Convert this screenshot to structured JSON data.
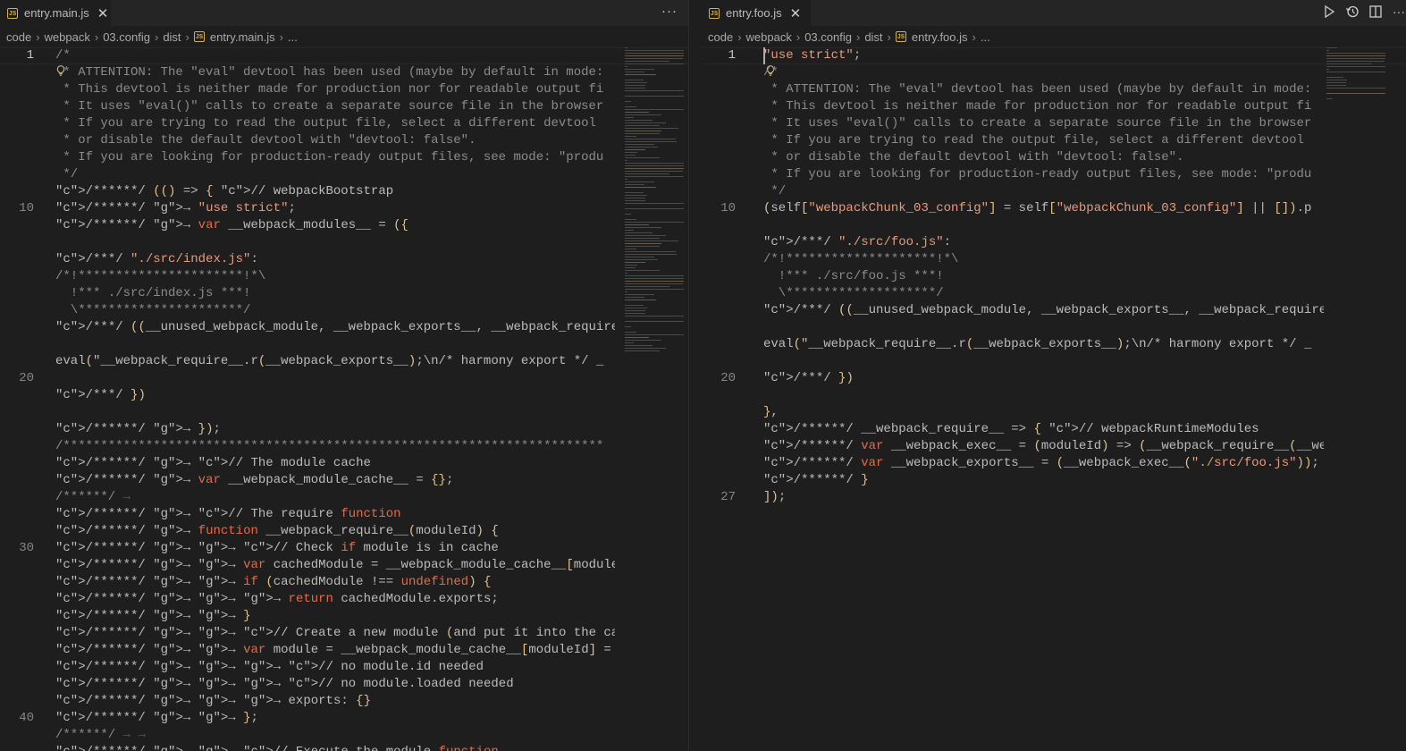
{
  "left_editor": {
    "tab": {
      "icon": "js-file-icon",
      "label": "entry.main.js"
    },
    "breadcrumb": [
      "code",
      "webpack",
      "03.config",
      "dist",
      "entry.main.js",
      "..."
    ],
    "line_numbers": [
      "1",
      "10",
      "20",
      "30",
      "40"
    ],
    "code_lines": [
      "/*",
      " * ATTENTION: The \"eval\" devtool has been used (maybe by default in mode:",
      " * This devtool is neither made for production nor for readable output fi",
      " * It uses \"eval()\" calls to create a separate source file in the browser",
      " * If you are trying to read the output file, select a different devtool",
      " * or disable the default devtool with \"devtool: false\".",
      " * If you are looking for production-ready output files, see mode: \"produ",
      " */",
      "/******/ (() => { // webpackBootstrap",
      "/******/ \t\"use strict\";",
      "/******/ \tvar __webpack_modules__ = ({",
      "",
      "/***/ \"./src/index.js\":",
      "/*!**********************!*\\",
      "  !*** ./src/index.js ***!",
      "  \\**********************/",
      "/***/ ((__unused_webpack_module, __webpack_exports__, __webpack_require__",
      "",
      "eval(\"__webpack_require__.r(__webpack_exports__);\\n/* harmony export */ _",
      "",
      "/***/ })",
      "",
      "/******/ \t});",
      "/************************************************************************",
      "/******/ \t// The module cache",
      "/******/ \tvar __webpack_module_cache__ = {};",
      "/******/ \t",
      "/******/ \t// The require function",
      "/******/ \tfunction __webpack_require__(moduleId) {",
      "/******/ \t\t// Check if module is in cache",
      "/******/ \t\tvar cachedModule = __webpack_module_cache__[moduleId];",
      "/******/ \t\tif (cachedModule !== undefined) {",
      "/******/ \t\t\treturn cachedModule.exports;",
      "/******/ \t\t}",
      "/******/ \t\t// Create a new module (and put it into the cache)",
      "/******/ \t\tvar module = __webpack_module_cache__[moduleId] = {",
      "/******/ \t\t\t// no module.id needed",
      "/******/ \t\t\t// no module.loaded needed",
      "/******/ \t\t\texports: {}",
      "/******/ \t\t};",
      "/******/ \t\t",
      "/******/ \t\t// Execute the module function"
    ]
  },
  "right_editor": {
    "tab": {
      "icon": "js-file-icon",
      "label": "entry.foo.js"
    },
    "breadcrumb": [
      "code",
      "webpack",
      "03.config",
      "dist",
      "entry.foo.js",
      "..."
    ],
    "line_numbers": [
      "1",
      "10",
      "20",
      "27"
    ],
    "code_lines": [
      "\"use strict\";",
      "/*",
      " * ATTENTION: The \"eval\" devtool has been used (maybe by default in mode:",
      " * This devtool is neither made for production nor for readable output fi",
      " * It uses \"eval()\" calls to create a separate source file in the browser",
      " * If you are trying to read the output file, select a different devtool",
      " * or disable the default devtool with \"devtool: false\".",
      " * If you are looking for production-ready output files, see mode: \"produ",
      " */",
      "(self[\"webpackChunk_03_config\"] = self[\"webpackChunk_03_config\"] || []).p",
      "",
      "/***/ \"./src/foo.js\":",
      "/*!********************!*\\",
      "  !*** ./src/foo.js ***!",
      "  \\********************/",
      "/***/ ((__unused_webpack_module, __webpack_exports__, __webpack_require__",
      "",
      "eval(\"__webpack_require__.r(__webpack_exports__);\\n/* harmony export */ _",
      "",
      "/***/ })",
      "",
      "},",
      "/******/ __webpack_require__ => { // webpackRuntimeModules",
      "/******/ var __webpack_exec__ = (moduleId) => (__webpack_require__(__webp",
      "/******/ var __webpack_exports__ = (__webpack_exec__(\"./src/foo.js\"));",
      "/******/ }",
      "]);"
    ]
  },
  "toolbar": {
    "more_actions": "···",
    "actions": [
      "run-icon",
      "timeline-icon",
      "split-editor-icon",
      "more-actions-icon"
    ]
  },
  "theme": {
    "background": "#1e1e1e",
    "tab_bar": "#252526",
    "string": "#e89a7a",
    "keyword": "#e06c4c",
    "comment": "#8b8b8b"
  }
}
